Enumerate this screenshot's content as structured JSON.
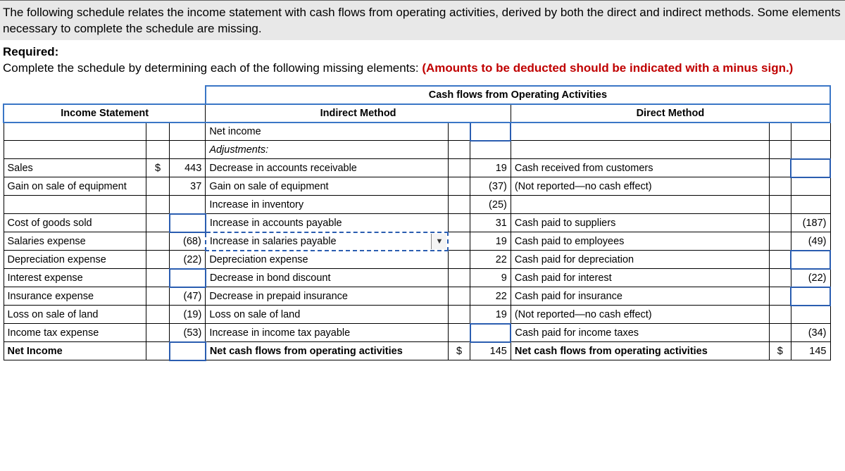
{
  "intro": "The following schedule relates the income statement with cash flows from operating activities, derived by both the direct and indirect methods. Some elements necessary to complete the schedule are missing.",
  "reqLabel": "Required:",
  "reqText": "Complete the schedule by determining each of the following missing elements: ",
  "reqRed": "(Amounts to be deducted should be indicated with a minus sign.)",
  "headers": {
    "super": "Cash flows from Operating Activities",
    "is": "Income Statement",
    "im": "Indirect Method",
    "dm": "Direct Method"
  },
  "rows": [
    {
      "is": "",
      "isCur": "",
      "isVal": "",
      "im": "Net income",
      "imCur": "",
      "imVal": "",
      "imValInput": true,
      "dm": "",
      "dmCur": "",
      "dmVal": ""
    },
    {
      "is": "",
      "isCur": "",
      "isVal": "",
      "im": "Adjustments:",
      "imItalic": true,
      "imCur": "",
      "imVal": "",
      "dm": "",
      "dmCur": "",
      "dmVal": ""
    },
    {
      "is": "Sales",
      "isCur": "$",
      "isVal": "443",
      "im": "Decrease in accounts receivable",
      "imCur": "",
      "imVal": "19",
      "dm": "Cash received from customers",
      "dmCur": "",
      "dmVal": "",
      "dmValInput": true
    },
    {
      "is": "Gain on sale of equipment",
      "isCur": "",
      "isVal": "37",
      "im": "Gain on sale of equipment",
      "imCur": "",
      "imVal": "(37)",
      "dm": "(Not reported—no cash effect)",
      "dmCur": "",
      "dmVal": ""
    },
    {
      "is": "",
      "isCur": "",
      "isVal": "",
      "im": "Increase in inventory",
      "imCur": "",
      "imVal": "(25)",
      "dm": "",
      "dmCur": "",
      "dmVal": ""
    },
    {
      "is": "Cost of goods sold",
      "isCur": "",
      "isVal": "",
      "isValInput": true,
      "im": "Increase in accounts payable",
      "imCur": "",
      "imVal": "31",
      "dm": "Cash paid to suppliers",
      "dmCur": "",
      "dmVal": "(187)"
    },
    {
      "is": "Salaries expense",
      "isCur": "",
      "isVal": "(68)",
      "im": "Increase in salaries payable",
      "imDashed": true,
      "imDropdown": true,
      "imCur": "",
      "imVal": "19",
      "dm": "Cash paid to employees",
      "dmCur": "",
      "dmVal": "(49)"
    },
    {
      "is": "Depreciation expense",
      "isCur": "",
      "isVal": "(22)",
      "im": "Depreciation expense",
      "imCur": "",
      "imVal": "22",
      "dm": "Cash paid for depreciation",
      "dmCur": "",
      "dmVal": "",
      "dmValInput": true
    },
    {
      "is": "Interest expense",
      "isCur": "",
      "isVal": "",
      "isValInput": true,
      "im": "Decrease in bond discount",
      "imCur": "",
      "imVal": "9",
      "dm": "Cash paid for interest",
      "dmCur": "",
      "dmVal": "(22)"
    },
    {
      "is": "Insurance expense",
      "isCur": "",
      "isVal": "(47)",
      "im": "Decrease in prepaid insurance",
      "imCur": "",
      "imVal": "22",
      "dm": "Cash paid for insurance",
      "dmCur": "",
      "dmVal": "",
      "dmValInput": true
    },
    {
      "is": "Loss on sale of land",
      "isCur": "",
      "isVal": "(19)",
      "im": "Loss on sale of land",
      "imCur": "",
      "imVal": "19",
      "dm": "(Not reported—no cash effect)",
      "dmCur": "",
      "dmVal": ""
    },
    {
      "is": "Income tax expense",
      "isCur": "",
      "isVal": "(53)",
      "im": "Increase in income tax payable",
      "imCur": "",
      "imVal": "",
      "imValInput": true,
      "dm": "Cash paid for income taxes",
      "dmCur": "",
      "dmVal": "(34)"
    },
    {
      "is": "Net Income",
      "isBold": true,
      "isCur": "",
      "isVal": "",
      "isValInput": true,
      "im": "Net cash flows from operating activities",
      "imBold": true,
      "imCur": "$",
      "imVal": "145",
      "dm": "Net cash flows from operating activities",
      "dmBold": true,
      "dmCur": "$",
      "dmVal": "145"
    }
  ]
}
